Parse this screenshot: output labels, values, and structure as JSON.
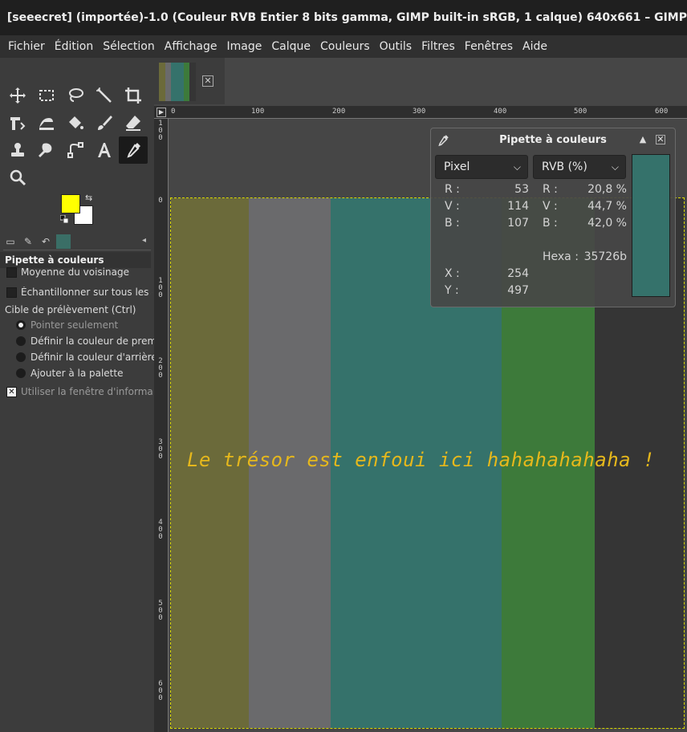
{
  "window": {
    "title": "[seeecret] (importée)-1.0 (Couleur RVB Entier 8 bits gamma, GIMP built-in sRGB, 1 calque) 640x661 – GIMP"
  },
  "menubar": {
    "items": [
      "Fichier",
      "Édition",
      "Sélection",
      "Affichage",
      "Image",
      "Calque",
      "Couleurs",
      "Outils",
      "Filtres",
      "Fenêtres",
      "Aide"
    ]
  },
  "colors": {
    "foreground": "#ffff00",
    "background": "#ffffff",
    "accent": "#35726b"
  },
  "tools": [
    "move-tool",
    "rect-select-tool",
    "free-select-tool",
    "fuzzy-select-tool",
    "crop-tool",
    "transform-tool",
    "warp-tool",
    "bucket-fill-tool",
    "paintbrush-tool",
    "eraser-tool",
    "clone-tool",
    "smudge-tool",
    "paths-tool",
    "text-tool",
    "color-picker-tool",
    "zoom-tool"
  ],
  "tool_options": {
    "title": "Pipette à couleurs",
    "sample_average": "Moyenne du voisinage",
    "sample_merged": "Échantillonner sur tous les calques",
    "target_label": "Cible de prélèvement  (Ctrl)",
    "radios": [
      "Pointer seulement",
      "Définir la couleur de premier plan",
      "Définir la couleur d'arrière-plan",
      "Ajouter à la palette"
    ],
    "use_info_window": "Utiliser la fenêtre d'information"
  },
  "rulers": {
    "horizontal": [
      "0",
      "100",
      "200",
      "300",
      "400",
      "500",
      "600"
    ],
    "vertical": [
      "100",
      "200",
      "300",
      "400",
      "500",
      "600"
    ]
  },
  "canvas": {
    "text": "Le trésor est enfoui ici hahahahahaha !",
    "stripes": [
      "#6b6a3a",
      "#6a6a6c",
      "#35726b",
      "#35726b",
      "#3d7a3a",
      "#353535"
    ]
  },
  "picker": {
    "title": "Pipette à couleurs",
    "mode_left": "Pixel",
    "mode_right": "RVB (%)",
    "pixel": {
      "r_label": "R :",
      "r": "53",
      "v_label": "V :",
      "v": "114",
      "b_label": "B :",
      "b": "107"
    },
    "percent": {
      "r_label": "R :",
      "r": "20,8 %",
      "v_label": "V :",
      "v": "44,7 %",
      "b_label": "B :",
      "b": "42,0 %"
    },
    "hex_label": "Hexa :",
    "hex": "35726b",
    "x_label": "X :",
    "x": "254",
    "y_label": "Y :",
    "y": "497",
    "swatch_color": "#35726b"
  }
}
